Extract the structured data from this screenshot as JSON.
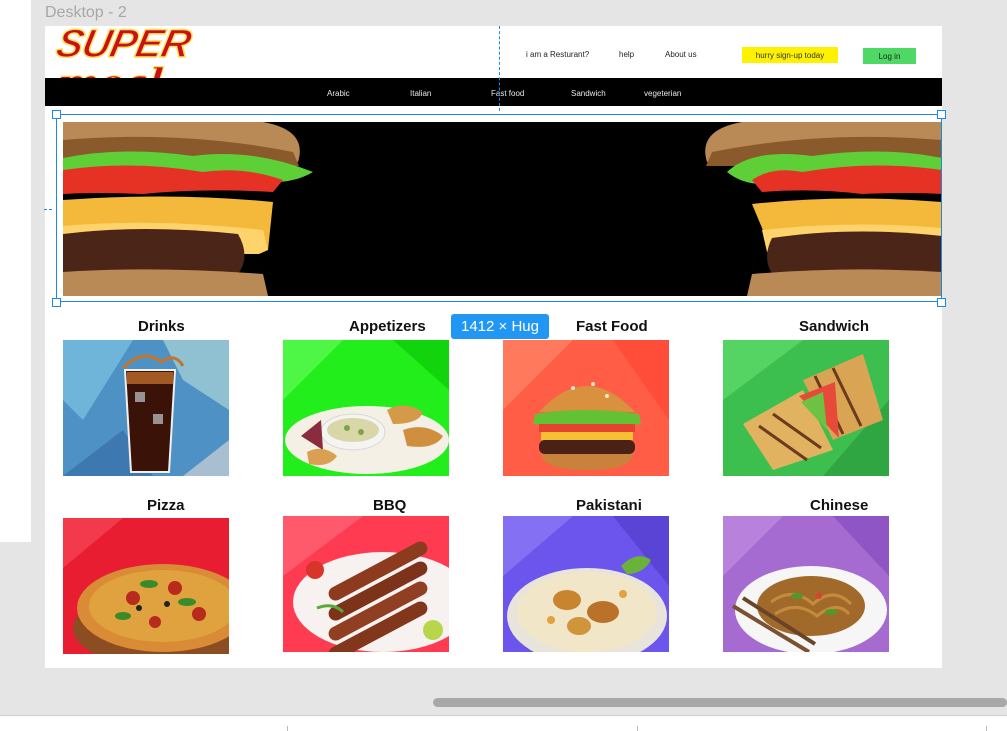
{
  "canvas": {
    "frame_label": "Desktop - 2",
    "dimension_badge": "1412 × Hug"
  },
  "header": {
    "logo_part1": "SUPER",
    "logo_part2": "meal",
    "links": [
      "i am a Resturant?",
      "help",
      "About us"
    ],
    "signup_label": "hurry sign-up today",
    "login_label": "Log in"
  },
  "nav": {
    "items": [
      "Arabic",
      "Italian",
      "Fast food",
      "Sandwich",
      "vegeterian"
    ]
  },
  "hero": {
    "image": "burger-banner"
  },
  "categories": [
    {
      "title": "Drinks",
      "image": "cola-glass",
      "bg": "#4e91c5"
    },
    {
      "title": "Appetizers",
      "image": "snack-platter",
      "bg": "#21ee1a"
    },
    {
      "title": "Fast Food",
      "image": "burger",
      "bg": "#ff5d45"
    },
    {
      "title": "Sandwich",
      "image": "grilled-sandwich",
      "bg": "#3cbf4f"
    },
    {
      "title": "Pizza",
      "image": "pizza",
      "bg": "#e81d32"
    },
    {
      "title": "BBQ",
      "image": "kebab-skewers",
      "bg": "#ff3b52"
    },
    {
      "title": "Pakistani",
      "image": "biryani",
      "bg": "#6b55ec"
    },
    {
      "title": "Chinese",
      "image": "noodles",
      "bg": "#a56bd0"
    }
  ],
  "colors": {
    "accent": "#1e88e5",
    "signup": "#fff200",
    "login": "#4dd964",
    "nav_bg": "#000000"
  }
}
